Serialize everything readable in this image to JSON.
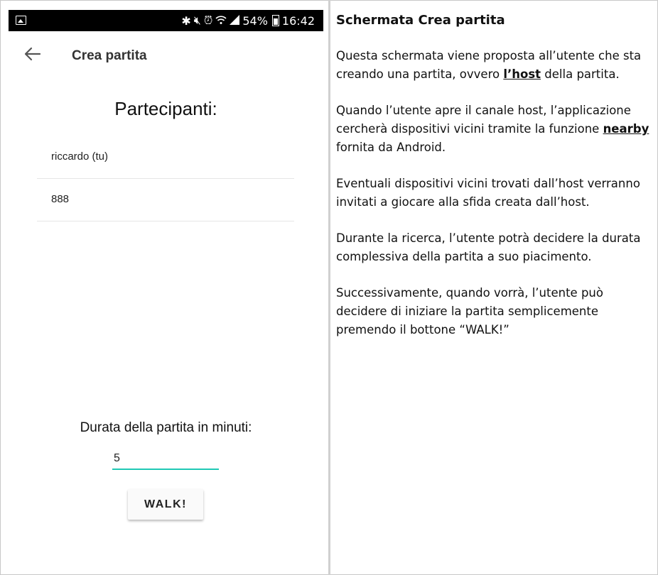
{
  "status_bar": {
    "battery": "54%",
    "time": "16:42"
  },
  "app_bar": {
    "title": "Crea partita"
  },
  "participants": {
    "title": "Partecipanti:",
    "items": [
      "riccardo (tu)",
      "888"
    ]
  },
  "duration": {
    "label": "Durata della partita in minuti:",
    "value": "5"
  },
  "walk_button": "WALK!",
  "doc": {
    "heading": "Schermata Crea partita",
    "p1": {
      "pre": "Questa schermata viene proposta all’utente che sta creando una partita, ovvero ",
      "bold": "l’host",
      "post": " della partita."
    },
    "p2": {
      "pre": "Quando l’utente apre il canale host, l’applicazione cercherà dispositivi vicini tramite la funzione ",
      "bold": "nearby",
      "post": " fornita da Android."
    },
    "p3": "Eventuali dispositivi vicini trovati dall’host verranno invitati a giocare alla sfida creata dall’host.",
    "p4": "Durante la ricerca, l’utente potrà decidere la durata complessiva della partita a suo piacimento.",
    "p5": "Successivamente, quando vorrà, l’utente può decidere di iniziare la partita semplicemente premendo il bottone “WALK!”"
  }
}
